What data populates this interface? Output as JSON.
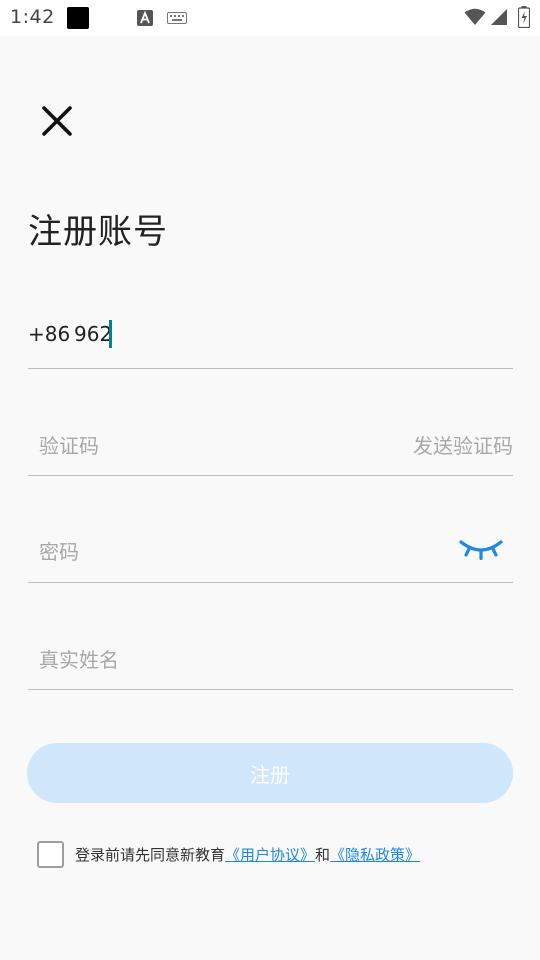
{
  "status_bar": {
    "time": "1:42"
  },
  "page": {
    "title": "注册账号"
  },
  "form": {
    "phone_prefix": "+86",
    "phone_value": "962",
    "code_placeholder": "验证码",
    "send_code_label": "发送验证码",
    "password_placeholder": "密码",
    "realname_placeholder": "真实姓名"
  },
  "register_button": {
    "label": "注册"
  },
  "agreement": {
    "checked": false,
    "prefix_text": "登录前请先同意新教育",
    "user_agreement_link": "《用户协议》",
    "and_text": "和",
    "privacy_link": "《隐私政策》"
  },
  "colors": {
    "accent": "#1e88e5",
    "button_disabled_bg": "#cfe6fb",
    "caret": "#00838f",
    "divider": "#bdbdbd"
  },
  "icons": [
    "close-icon",
    "eye-closed-icon",
    "wifi-icon",
    "signal-icon",
    "battery-icon",
    "keyboard-icon"
  ]
}
